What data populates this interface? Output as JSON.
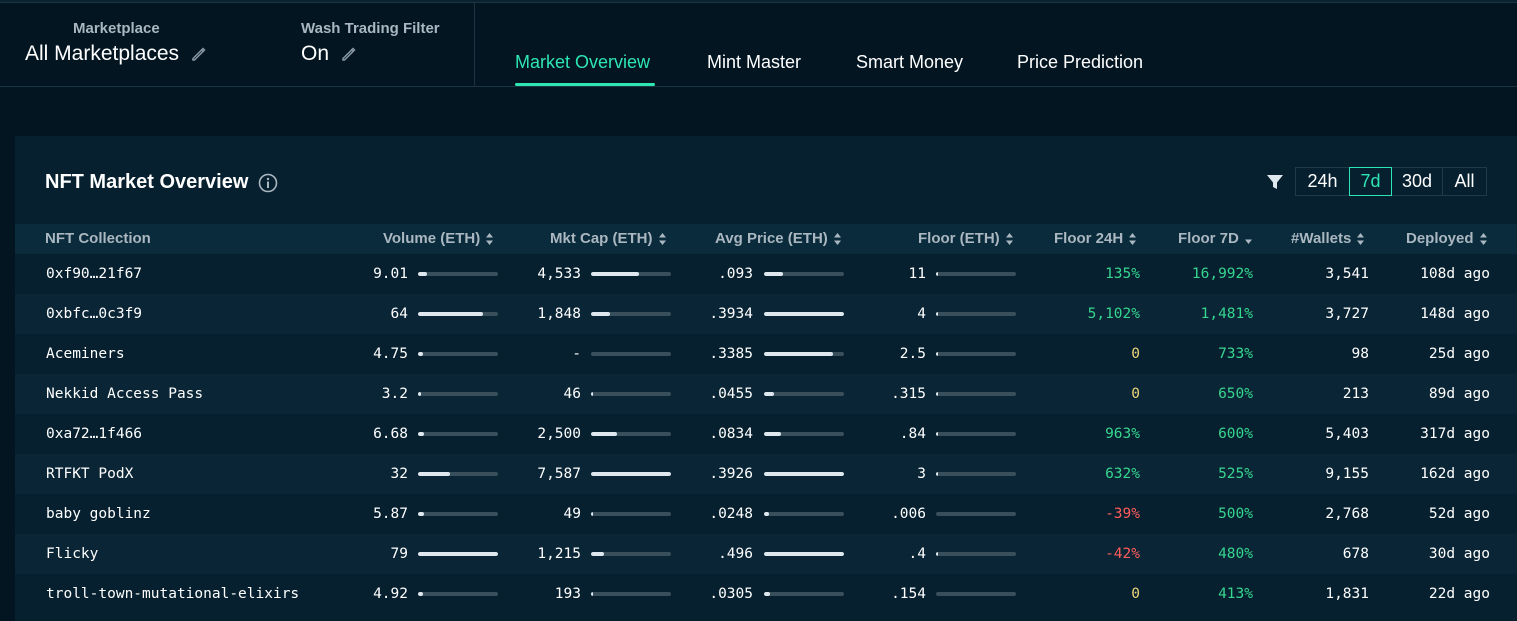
{
  "filters": {
    "marketplace": {
      "label": "Marketplace",
      "value": "All Marketplaces"
    },
    "wash": {
      "label": "Wash Trading Filter",
      "value": "On"
    }
  },
  "tabs": [
    {
      "label": "Market Overview",
      "active": true
    },
    {
      "label": "Mint Master",
      "active": false
    },
    {
      "label": "Smart Money",
      "active": false
    },
    {
      "label": "Price Prediction",
      "active": false
    }
  ],
  "panel": {
    "title": "NFT Market Overview",
    "ranges": [
      "24h",
      "7d",
      "30d",
      "All"
    ],
    "active_range": "7d"
  },
  "columns": {
    "collection": "NFT Collection",
    "volume": "Volume (ETH)",
    "mktcap": "Mkt Cap (ETH)",
    "avgprice": "Avg Price (ETH)",
    "floor": "Floor (ETH)",
    "floor24": "Floor 24H",
    "floor7": "Floor 7D",
    "wallets": "#Wallets",
    "deployed": "Deployed"
  },
  "rows": [
    {
      "name": "0xf90…21f67",
      "volume": "9.01",
      "volume_bar": 0.11,
      "mktcap": "4,533",
      "mktcap_bar": 0.6,
      "avgprice": ".093",
      "avgprice_bar": 0.24,
      "floor": "11",
      "floor_bar": 0.02,
      "floor24": "135%",
      "floor24_tone": "pos",
      "floor7": "16,992%",
      "floor7_tone": "pos",
      "wallets": "3,541",
      "deployed": "108d ago"
    },
    {
      "name": "0xbfc…0c3f9",
      "volume": "64",
      "volume_bar": 0.81,
      "mktcap": "1,848",
      "mktcap_bar": 0.24,
      "avgprice": ".3934",
      "avgprice_bar": 1.0,
      "floor": "4",
      "floor_bar": 0.007,
      "floor24": "5,102%",
      "floor24_tone": "pos",
      "floor7": "1,481%",
      "floor7_tone": "pos",
      "wallets": "3,727",
      "deployed": "148d ago"
    },
    {
      "name": "Aceminers",
      "volume": "4.75",
      "volume_bar": 0.06,
      "mktcap": "-",
      "mktcap_bar": 0,
      "avgprice": ".3385",
      "avgprice_bar": 0.86,
      "floor": "2.5",
      "floor_bar": 0.005,
      "floor24": "0",
      "floor24_tone": "zero",
      "floor7": "733%",
      "floor7_tone": "pos",
      "wallets": "98",
      "deployed": "25d ago"
    },
    {
      "name": "Nekkid Access Pass",
      "volume": "3.2",
      "volume_bar": 0.04,
      "mktcap": "46",
      "mktcap_bar": 0.006,
      "avgprice": ".0455",
      "avgprice_bar": 0.12,
      "floor": ".315",
      "floor_bar": 0.001,
      "floor24": "0",
      "floor24_tone": "zero",
      "floor7": "650%",
      "floor7_tone": "pos",
      "wallets": "213",
      "deployed": "89d ago"
    },
    {
      "name": "0xa72…1f466",
      "volume": "6.68",
      "volume_bar": 0.08,
      "mktcap": "2,500",
      "mktcap_bar": 0.33,
      "avgprice": ".0834",
      "avgprice_bar": 0.21,
      "floor": ".84",
      "floor_bar": 0.002,
      "floor24": "963%",
      "floor24_tone": "pos",
      "floor7": "600%",
      "floor7_tone": "pos",
      "wallets": "5,403",
      "deployed": "317d ago"
    },
    {
      "name": "RTFKT PodX",
      "volume": "32",
      "volume_bar": 0.4,
      "mktcap": "7,587",
      "mktcap_bar": 1.0,
      "avgprice": ".3926",
      "avgprice_bar": 1.0,
      "floor": "3",
      "floor_bar": 0.006,
      "floor24": "632%",
      "floor24_tone": "pos",
      "floor7": "525%",
      "floor7_tone": "pos",
      "wallets": "9,155",
      "deployed": "162d ago"
    },
    {
      "name": "baby goblinz",
      "volume": "5.87",
      "volume_bar": 0.07,
      "mktcap": "49",
      "mktcap_bar": 0.006,
      "avgprice": ".0248",
      "avgprice_bar": 0.06,
      "floor": ".006",
      "floor_bar": 0.0,
      "floor24": "-39%",
      "floor24_tone": "neg",
      "floor7": "500%",
      "floor7_tone": "pos",
      "wallets": "2,768",
      "deployed": "52d ago"
    },
    {
      "name": "Flicky",
      "volume": "79",
      "volume_bar": 1.0,
      "mktcap": "1,215",
      "mktcap_bar": 0.16,
      "avgprice": ".496",
      "avgprice_bar": 1.0,
      "floor": ".4",
      "floor_bar": 0.001,
      "floor24": "-42%",
      "floor24_tone": "neg",
      "floor7": "480%",
      "floor7_tone": "pos",
      "wallets": "678",
      "deployed": "30d ago"
    },
    {
      "name": "troll-town-mutational-elixirs",
      "volume": "4.92",
      "volume_bar": 0.06,
      "mktcap": "193",
      "mktcap_bar": 0.025,
      "avgprice": ".0305",
      "avgprice_bar": 0.08,
      "floor": ".154",
      "floor_bar": 0.0,
      "floor24": "0",
      "floor24_tone": "zero",
      "floor7": "413%",
      "floor7_tone": "pos",
      "wallets": "1,831",
      "deployed": "22d ago"
    }
  ],
  "icons": {
    "edit": "pencil-icon",
    "info": "info-icon",
    "filter": "funnel-icon",
    "sort": "sort-icon"
  },
  "colors": {
    "accent": "#2ee6b4",
    "positive": "#37d68f",
    "negative": "#ff5c5c",
    "neutral": "#f0d67a"
  }
}
